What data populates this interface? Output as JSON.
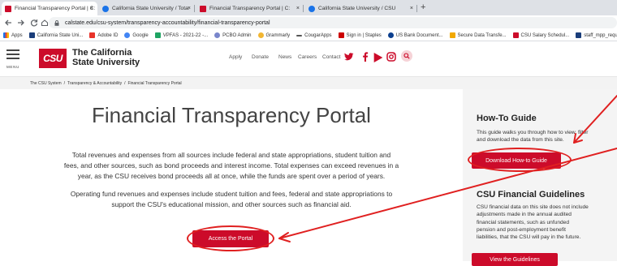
{
  "browser": {
    "tabs": [
      {
        "title": "Financial Transparency Portal | C:",
        "favicon_color": "#cc0b2a"
      },
      {
        "title": "California State University / Tota:",
        "favicon_color": "#1a73e8"
      },
      {
        "title": "Financial Transparency Portal | C:",
        "favicon_color": "#cc0b2a"
      },
      {
        "title": "California State University / CSU",
        "favicon_color": "#1a73e8"
      }
    ],
    "new_tab": "+",
    "close_glyph": "×",
    "url": "calstate.edu/csu-system/transparency-accountability/financial-transparency-portal",
    "bookmarks": [
      {
        "label": "Apps",
        "color": "#1a73e8"
      },
      {
        "label": "California State Uni...",
        "color": "#1a3d7a"
      },
      {
        "label": "Adobe ID",
        "color": "#e8332a"
      },
      {
        "label": "Google",
        "color": "#4285f4"
      },
      {
        "label": "VPFAS - 2021-22 -...",
        "color": "#1fa463"
      },
      {
        "label": "PCBO Admin",
        "color": "#7986cb"
      },
      {
        "label": "Grammarly",
        "color": "#f2b632"
      },
      {
        "label": "CougarApps",
        "color": "#555555"
      },
      {
        "label": "Sign in | Staples",
        "color": "#cc0000"
      },
      {
        "label": "US Bank Document...",
        "color": "#0c3f8e"
      },
      {
        "label": "Secure Data Transfe...",
        "color": "#f2a900"
      },
      {
        "label": "CSU Salary Schedul...",
        "color": "#cc0b2a"
      },
      {
        "label": "staff_mpp_requis",
        "color": "#1a3d7a"
      }
    ]
  },
  "header": {
    "menu_label": "MENU",
    "logo_mark": "CSU",
    "logo_line1": "The California",
    "logo_line2": "State University",
    "nav": [
      "Apply",
      "Donate",
      "News",
      "Careers",
      "Contact"
    ],
    "social_icons": [
      "twitter-icon",
      "facebook-icon",
      "youtube-icon",
      "instagram-icon"
    ],
    "accent": "#cc0b2a"
  },
  "breadcrumb": {
    "items": [
      "The CSU System",
      "Transparency & Accountability",
      "Financial Transparency Portal"
    ],
    "separator": "/"
  },
  "main": {
    "title": "Financial Transparency Portal",
    "paragraph1": [
      "Total revenues and expenses from all sources include federal and state appropriations, student tuition and",
      "fees, and other sources, such as bond proceeds and interest income. Total expenses can exceed revenues in a",
      "year, as the CSU receives bond proceeds all at once, while the funds are spent over a period of years."
    ],
    "paragraph2": [
      "Operating fund revenues and expenses include student tuition and fees, federal and state appropriations to",
      "support the CSU's educational mission, and other sources such as financial aid."
    ],
    "access_button": "Access the Portal"
  },
  "sidebar": {
    "howto_heading": "How-To Guide",
    "howto_text": [
      "This guide walks you through how to view, filter",
      "and download the data from this site."
    ],
    "howto_button": "Download How-to Guide",
    "guidelines_heading": "CSU Financial Guidelines",
    "guidelines_text": [
      "CSU financial data on this site does not include",
      "adjustments made in the annual audited",
      "financial statements, such as unfunded",
      "pension and post-employment benefit",
      "liabilities, that the CSU will pay in the future."
    ],
    "guidelines_button": "View the Guidelines"
  },
  "annotation_color": "#e02020"
}
